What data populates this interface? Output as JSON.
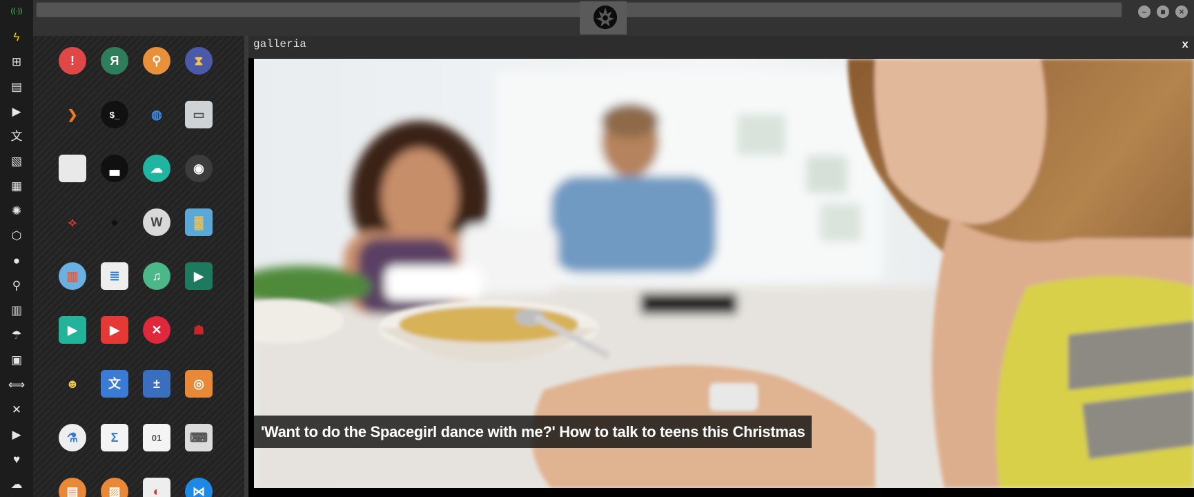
{
  "window": {
    "tab_title": "galleria",
    "close_label": "x"
  },
  "caption": "'Want to do the Spacegirl dance with me?' How to talk to teens this Christmas",
  "titlebar": {
    "minimize_label": "–",
    "maximize_label": "■",
    "close_label": "×"
  },
  "sidebar_icons": [
    {
      "name": "wifi-icon",
      "glyph": "((·))",
      "color": "#4cd964"
    },
    {
      "name": "lightning-icon",
      "glyph": "ϟ",
      "color": "#ffcc00"
    },
    {
      "name": "windows-icon",
      "glyph": "⊞",
      "color": "#e6e6e6"
    },
    {
      "name": "archive-icon",
      "glyph": "▤",
      "color": "#e6e6e6"
    },
    {
      "name": "play-circle-icon",
      "glyph": "▶",
      "color": "#e6e6e6"
    },
    {
      "name": "translate-icon",
      "glyph": "文",
      "color": "#e6e6e6"
    },
    {
      "name": "image-icon",
      "glyph": "▧",
      "color": "#e6e6e6"
    },
    {
      "name": "newspaper-icon",
      "glyph": "▦",
      "color": "#e6e6e6"
    },
    {
      "name": "rebel-icon",
      "glyph": "✺",
      "color": "#e6e6e6"
    },
    {
      "name": "network-icon",
      "glyph": "⬡",
      "color": "#e6e6e6"
    },
    {
      "name": "globe-icon",
      "glyph": "●",
      "color": "#e6e6e6"
    },
    {
      "name": "search-icon",
      "glyph": "⚲",
      "color": "#e6e6e6"
    },
    {
      "name": "map-icon",
      "glyph": "▥",
      "color": "#e6e6e6"
    },
    {
      "name": "umbrella-icon",
      "glyph": "☂",
      "color": "#e6e6e6"
    },
    {
      "name": "contact-icon",
      "glyph": "▣",
      "color": "#e6e6e6"
    },
    {
      "name": "link-icon",
      "glyph": "⟺",
      "color": "#e6e6e6"
    },
    {
      "name": "expand-icon",
      "glyph": "✕",
      "color": "#e6e6e6"
    },
    {
      "name": "youtube-icon",
      "glyph": "▶",
      "color": "#e6e6e6"
    },
    {
      "name": "heart-icon",
      "glyph": "♥",
      "color": "#e6e6e6"
    },
    {
      "name": "cloud-icon",
      "glyph": "☁",
      "color": "#e6e6e6"
    }
  ],
  "apps": [
    {
      "name": "warning-app-icon",
      "glyph": "!",
      "bg": "#e04848",
      "fg": "#ffffff",
      "shape": "round"
    },
    {
      "name": "yandex-app-icon",
      "glyph": "Я",
      "bg": "#2e7d5b",
      "fg": "#ffffff",
      "shape": "round"
    },
    {
      "name": "search-app-icon",
      "glyph": "⚲",
      "bg": "#e8913a",
      "fg": "#ffffff",
      "shape": "round"
    },
    {
      "name": "hourglass-app-icon",
      "glyph": "⧗",
      "bg": "#4a5aa8",
      "fg": "#f2c14e",
      "shape": "round"
    },
    {
      "name": "arrow-app-icon",
      "glyph": "❯",
      "bg": "transparent",
      "fg": "#f07a20",
      "shape": "sq"
    },
    {
      "name": "terminal-app-icon",
      "glyph": "$_",
      "bg": "#111111",
      "fg": "#ffffff",
      "shape": "round"
    },
    {
      "name": "globe-app-icon",
      "glyph": "◍",
      "bg": "transparent",
      "fg": "#3a8ee6",
      "shape": "round"
    },
    {
      "name": "drive-app-icon",
      "glyph": "▭",
      "bg": "#cfd3d6",
      "fg": "#555555",
      "shape": "sq"
    },
    {
      "name": "window-app-icon",
      "glyph": "",
      "bg": "#e9e9e9",
      "fg": "#555555",
      "shape": "sq"
    },
    {
      "name": "steam-app-icon",
      "glyph": "▃",
      "bg": "#101010",
      "fg": "#ffffff",
      "shape": "round"
    },
    {
      "name": "cloud-lock-app-icon",
      "glyph": "☁",
      "bg": "#1fb5a0",
      "fg": "#ffffff",
      "shape": "round"
    },
    {
      "name": "github-app-icon",
      "glyph": "◉",
      "bg": "#3c3c3c",
      "fg": "#ffffff",
      "shape": "round"
    },
    {
      "name": "starfleet-app-icon",
      "glyph": "⟡",
      "bg": "transparent",
      "fg": "#d33a2c",
      "shape": "sq"
    },
    {
      "name": "deathstar-app-icon",
      "glyph": "●",
      "bg": "transparent",
      "fg": "#101010",
      "shape": "round"
    },
    {
      "name": "wikipedia-app-icon",
      "glyph": "W",
      "bg": "#d9d9d9",
      "fg": "#444444",
      "shape": "round"
    },
    {
      "name": "worldmap-app-icon",
      "glyph": "▓",
      "bg": "#5aa8d8",
      "fg": "#f2c14e",
      "shape": "sq"
    },
    {
      "name": "books-app-icon",
      "glyph": "▥",
      "bg": "#6ab0e0",
      "fg": "#e85a3a",
      "shape": "round"
    },
    {
      "name": "notepad-app-icon",
      "glyph": "≣",
      "bg": "#eeeeee",
      "fg": "#3a7bd5",
      "shape": "sq"
    },
    {
      "name": "music-app-icon",
      "glyph": "♫",
      "bg": "#4cb88a",
      "fg": "#ffffff",
      "shape": "round"
    },
    {
      "name": "video-app-icon",
      "glyph": "▶",
      "bg": "#1e7a5e",
      "fg": "#ffffff",
      "shape": "sq"
    },
    {
      "name": "player-app-icon",
      "glyph": "▶",
      "bg": "#22b39a",
      "fg": "#ffffff",
      "shape": "sq"
    },
    {
      "name": "youtube-red-app-icon",
      "glyph": "▶",
      "bg": "#e53935",
      "fg": "#ffffff",
      "shape": "sq"
    },
    {
      "name": "error-app-icon",
      "glyph": "✕",
      "bg": "#e0283c",
      "fg": "#ffffff",
      "shape": "round"
    },
    {
      "name": "ironman-app-icon",
      "glyph": "☗",
      "bg": "transparent",
      "fg": "#c62828",
      "shape": "sq"
    },
    {
      "name": "robot-app-icon",
      "glyph": "☻",
      "bg": "transparent",
      "fg": "#e8c34a",
      "shape": "round"
    },
    {
      "name": "translate-app-icon",
      "glyph": "文",
      "bg": "#3a7bd5",
      "fg": "#ffffff",
      "shape": "sq"
    },
    {
      "name": "calculator-app-icon",
      "glyph": "±",
      "bg": "#3a6fc0",
      "fg": "#ffffff",
      "shape": "sq"
    },
    {
      "name": "photo-app-icon",
      "glyph": "◎",
      "bg": "#e8893a",
      "fg": "#ffffff",
      "shape": "sq"
    },
    {
      "name": "flask-app-icon",
      "glyph": "⚗",
      "bg": "#eeeeee",
      "fg": "#3a7bd5",
      "shape": "round"
    },
    {
      "name": "sigma-app-icon",
      "glyph": "Σ",
      "bg": "#f4f4f4",
      "fg": "#3a7bd5",
      "shape": "sq"
    },
    {
      "name": "binary-app-icon",
      "glyph": "01",
      "bg": "#f4f4f4",
      "fg": "#555555",
      "shape": "sq"
    },
    {
      "name": "keyboard-app-icon",
      "glyph": "⌨",
      "bg": "#dcdcdc",
      "fg": "#555555",
      "shape": "sq"
    },
    {
      "name": "document-app-icon",
      "glyph": "▤",
      "bg": "#e8893a",
      "fg": "#ffffff",
      "shape": "round"
    },
    {
      "name": "image-viewer-app-icon",
      "glyph": "▨",
      "bg": "#e8893a",
      "fg": "#ffffff",
      "shape": "round"
    },
    {
      "name": "presentation-app-icon",
      "glyph": "◐",
      "bg": "#eeeeee",
      "fg": "#d33a2c",
      "shape": "sq"
    },
    {
      "name": "vscode-app-icon",
      "glyph": "⋈",
      "bg": "#1e88e5",
      "fg": "#ffffff",
      "shape": "round"
    }
  ]
}
